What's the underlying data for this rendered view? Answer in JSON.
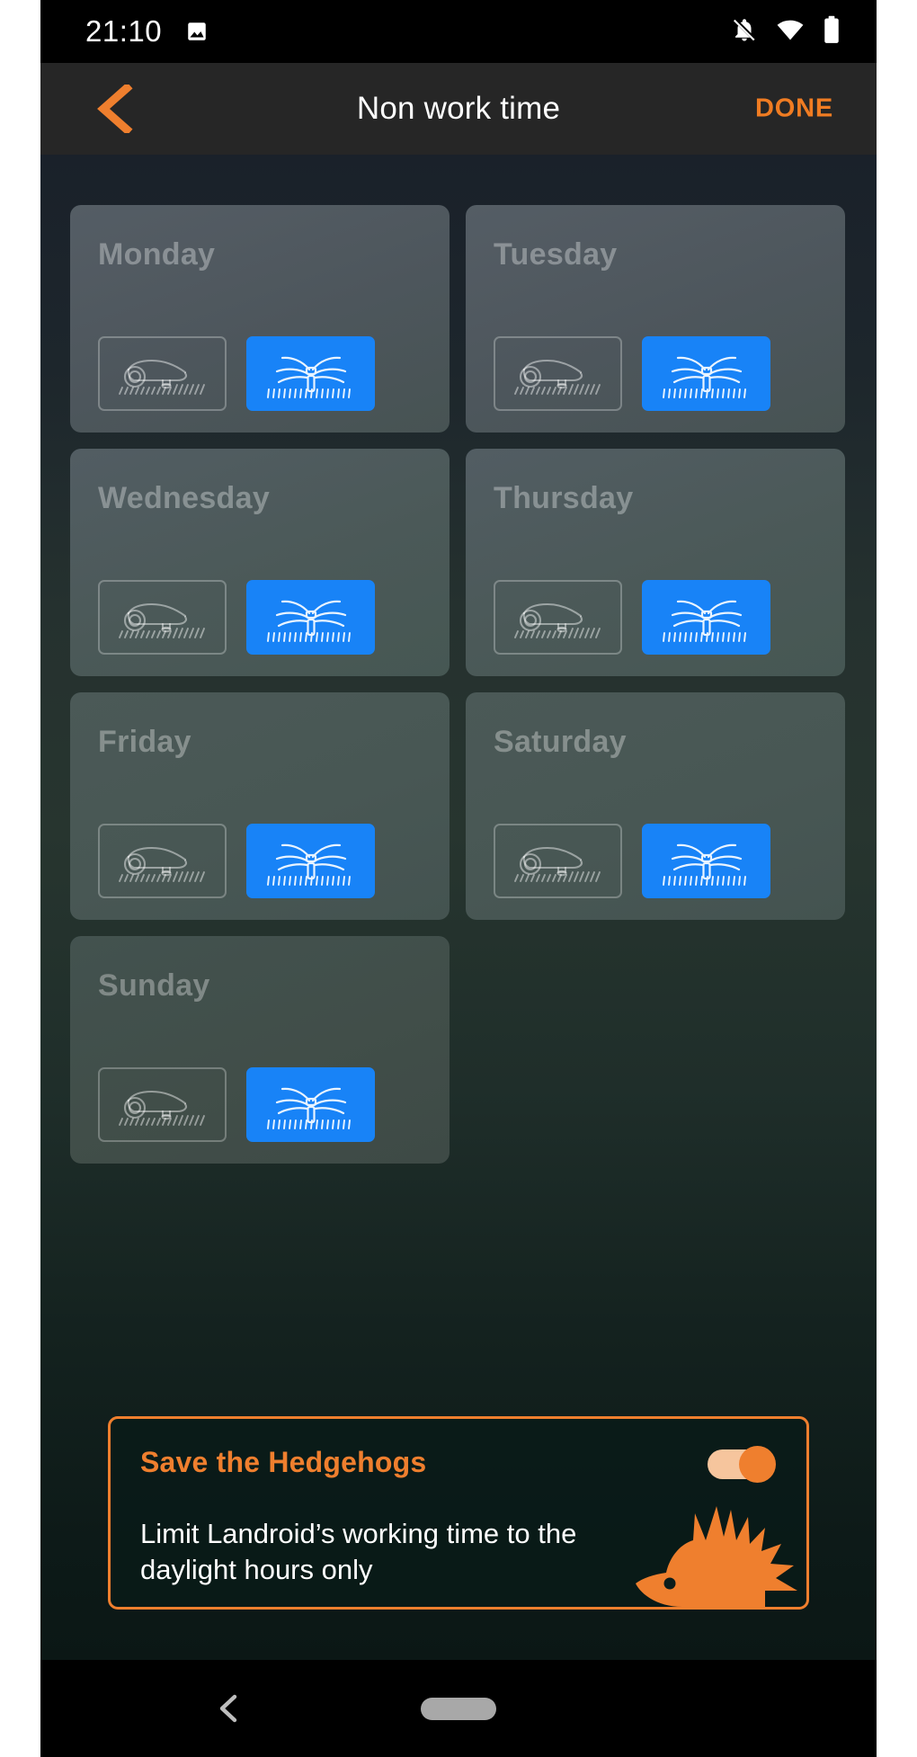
{
  "status_bar": {
    "time": "21:10",
    "icons": [
      "image-icon",
      "notifications-off-icon",
      "wifi-icon",
      "battery-full-icon"
    ]
  },
  "header": {
    "back_label": "back-chevron",
    "title": "Non work time",
    "done_label": "DONE"
  },
  "schedule": {
    "mode_off_label": "mower-icon",
    "mode_on_label": "sprinkler-icon",
    "days": [
      {
        "name": "Monday",
        "mower_selected": false,
        "sprinkler_selected": true
      },
      {
        "name": "Tuesday",
        "mower_selected": false,
        "sprinkler_selected": true
      },
      {
        "name": "Wednesday",
        "mower_selected": false,
        "sprinkler_selected": true
      },
      {
        "name": "Thursday",
        "mower_selected": false,
        "sprinkler_selected": true
      },
      {
        "name": "Friday",
        "mower_selected": false,
        "sprinkler_selected": true
      },
      {
        "name": "Saturday",
        "mower_selected": false,
        "sprinkler_selected": true
      },
      {
        "name": "Sunday",
        "mower_selected": false,
        "sprinkler_selected": true
      }
    ]
  },
  "hedgehog_panel": {
    "title": "Save the Hedgehogs",
    "description": "Limit Landroid’s working time to the daylight hours only",
    "toggle_on": true
  },
  "nav_bar": {
    "back": "nav-back-icon",
    "home": "nav-home-pill"
  },
  "colors": {
    "accent_orange": "#ef7f2e",
    "selected_blue": "#0b7cf7",
    "appbar_bg": "#262626",
    "card_text": "rgba(255,255,255,0.33)"
  }
}
